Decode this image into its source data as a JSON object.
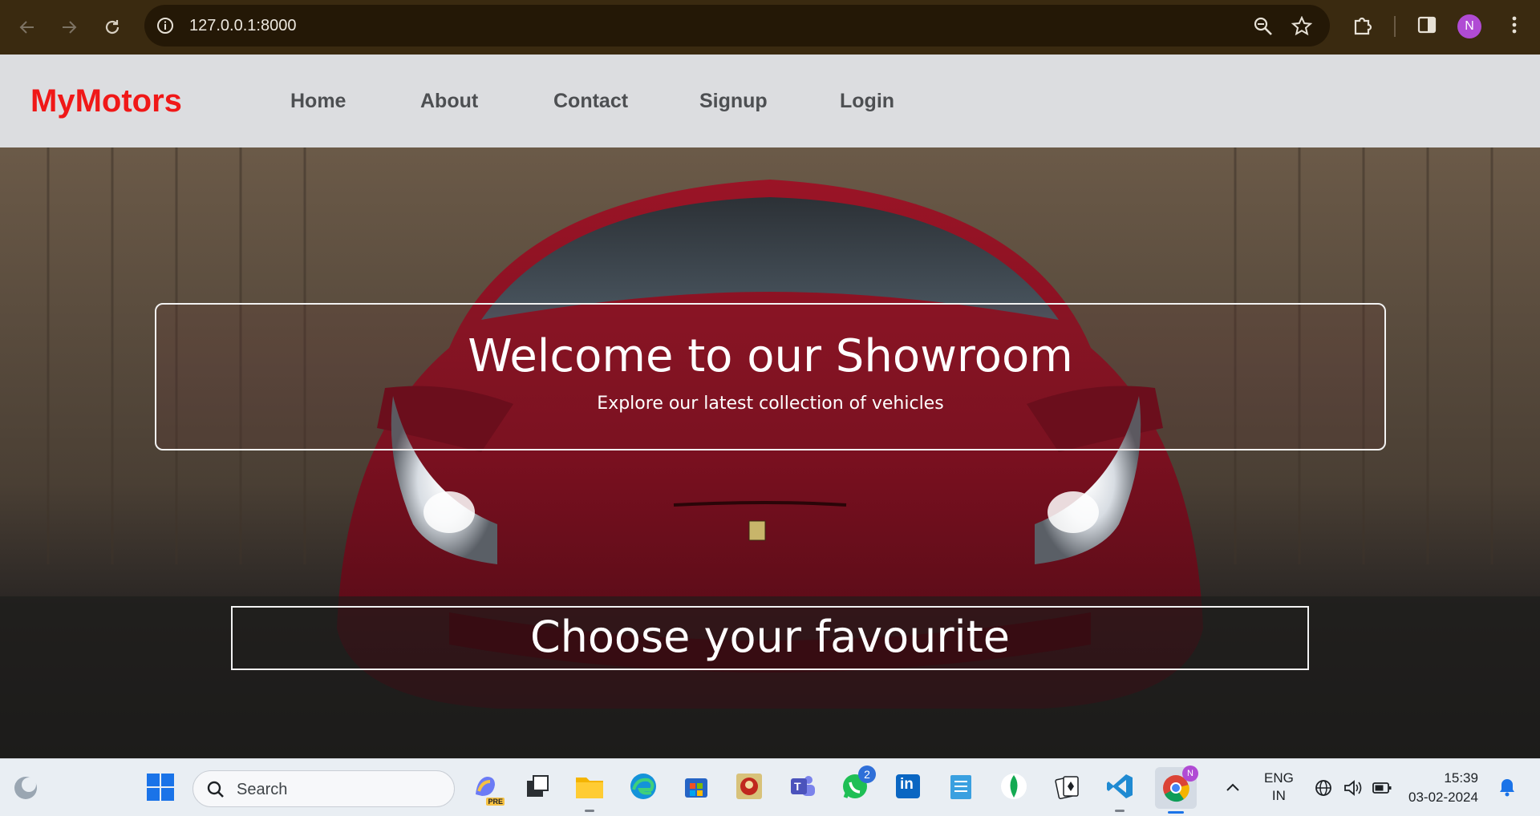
{
  "browser": {
    "url": "127.0.0.1:8000",
    "profile_initial": "N",
    "theme_color": "#3a2a10"
  },
  "site": {
    "brand": "MyMotors",
    "brand_color": "#f01818",
    "nav": [
      "Home",
      "About",
      "Contact",
      "Signup",
      "Login"
    ],
    "welcome_title": "Welcome to our Showroom",
    "welcome_subtitle": "Explore our latest collection of vehicles",
    "choose_title": "Choose your favourite"
  },
  "taskbar": {
    "search_placeholder": "Search",
    "apps": [
      "copilot-icon",
      "task-view-icon",
      "file-explorer-icon",
      "edge-icon",
      "store-icon",
      "game-icon",
      "teams-icon",
      "whatsapp-icon",
      "linkedin-icon",
      "notepad-icon",
      "mongodb-icon",
      "solitaire-icon",
      "vscode-icon",
      "chrome-icon"
    ],
    "whatsapp_badge": "2",
    "copilot_tag": "PRE",
    "teams_letter": "T",
    "linkedin_letters": "in",
    "language": "ENG",
    "region": "IN",
    "time": "15:39",
    "date": "03-02-2024"
  }
}
